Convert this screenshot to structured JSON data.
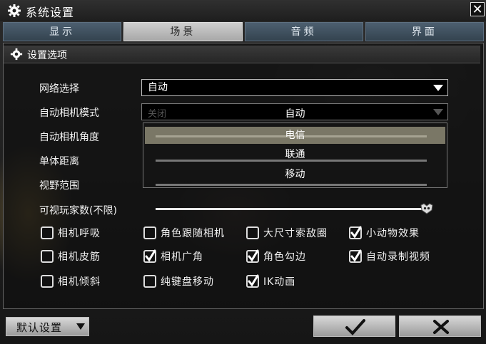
{
  "window": {
    "title": "系统设置",
    "close_label": "✕"
  },
  "tabs": [
    {
      "label": "显示",
      "active": false
    },
    {
      "label": "场景",
      "active": true
    },
    {
      "label": "音频",
      "active": false
    },
    {
      "label": "界面",
      "active": false
    }
  ],
  "section": {
    "title": "设置选项"
  },
  "settings": {
    "network": {
      "label": "网络选择",
      "value": "自动"
    },
    "auto_camera_mode": {
      "label": "自动相机模式",
      "value": "关闭"
    },
    "auto_camera_angle": {
      "label": "自动相机角度"
    },
    "body_distance": {
      "label": "单体距离"
    },
    "view_range": {
      "label": "视野范围"
    },
    "visible_players": {
      "label": "可视玩家数(不限)",
      "level_percent": 100
    }
  },
  "dropdown": {
    "options": [
      "自动",
      "电信",
      "联通",
      "移动"
    ],
    "highlighted": "电信"
  },
  "checkboxes": [
    {
      "label": "相机呼吸",
      "checked": false
    },
    {
      "label": "角色跟随相机",
      "checked": false
    },
    {
      "label": "大尺寸索敌圈",
      "checked": false
    },
    {
      "label": "小动物效果",
      "checked": true
    },
    {
      "label": "相机皮筋",
      "checked": false
    },
    {
      "label": "相机广角",
      "checked": true
    },
    {
      "label": "角色勾边",
      "checked": true
    },
    {
      "label": "自动录制视频",
      "checked": true
    },
    {
      "label": "相机倾斜",
      "checked": false
    },
    {
      "label": "纯键盘移动",
      "checked": false
    },
    {
      "label": "IK动画",
      "checked": true
    }
  ],
  "footer": {
    "default_label": "默认设置",
    "confirm_icon": "check-icon",
    "cancel_icon": "cancel-icon"
  },
  "colors": {
    "tab_inactive": "#3f4f5d",
    "tab_active": "#bdbdbd",
    "highlight": "#cdc8aa"
  }
}
